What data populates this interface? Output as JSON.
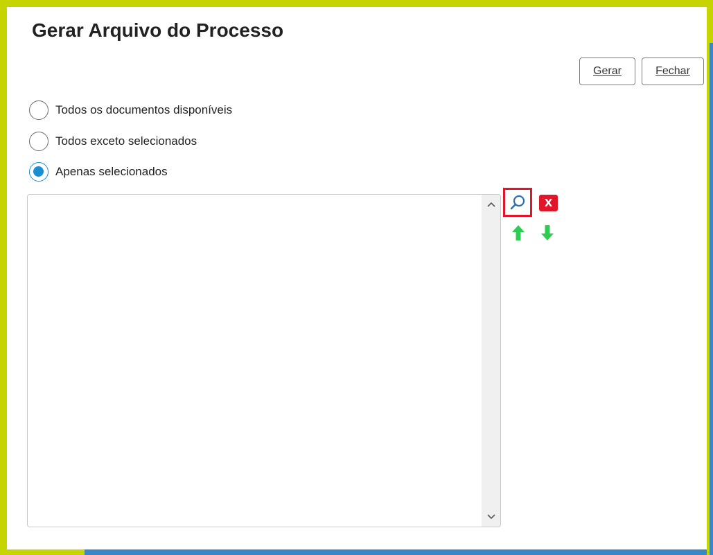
{
  "dialog": {
    "title": "Gerar Arquivo do Processo"
  },
  "toolbar": {
    "gerar_label": "Gerar",
    "fechar_label": "Fechar"
  },
  "options": [
    {
      "label": "Todos os documentos disponíveis",
      "checked": false
    },
    {
      "label": "Todos exceto selecionados",
      "checked": false
    },
    {
      "label": "Apenas selecionados",
      "checked": true
    }
  ],
  "selected_documents": {
    "items": []
  },
  "actions": {
    "search_icon": "search-icon",
    "delete_icon": "delete-icon",
    "delete_glyph": "X",
    "move_up_icon": "arrow-up-icon",
    "move_down_icon": "arrow-down-icon"
  },
  "colors": {
    "frame_accent": "#c6d400",
    "frame_blue": "#3a87c8",
    "radio_selected": "#1a8fd0",
    "highlight_red": "#e0162b",
    "arrow_green": "#2ecc52",
    "search_blue": "#2a6fb5"
  }
}
